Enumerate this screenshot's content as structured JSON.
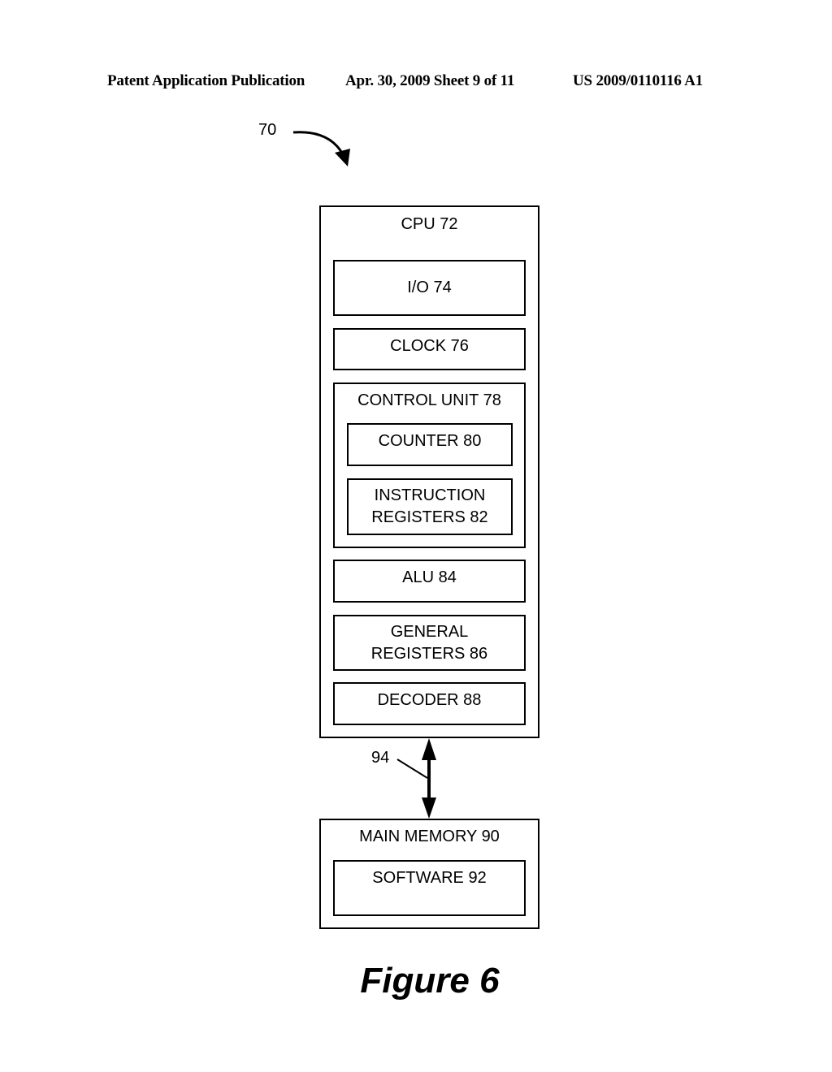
{
  "header": {
    "publication": "Patent Application Publication",
    "date_sheet": "Apr. 30, 2009  Sheet 9 of 11",
    "patent_number": "US 2009/0110116 A1"
  },
  "diagram": {
    "system_ref": "70",
    "cpu": {
      "label": "CPU 72",
      "blocks": {
        "io": "I/O 74",
        "clock": "CLOCK 76",
        "control_unit": {
          "label": "CONTROL UNIT 78",
          "counter": "COUNTER 80",
          "instruction_registers": [
            "INSTRUCTION",
            "REGISTERS 82"
          ]
        },
        "alu": "ALU 84",
        "general_registers": [
          "GENERAL",
          "REGISTERS 86"
        ],
        "decoder": "DECODER 88"
      }
    },
    "bus_ref": "94",
    "main_memory": {
      "label": "MAIN MEMORY 90",
      "software": "SOFTWARE 92"
    }
  },
  "caption": "Figure 6"
}
